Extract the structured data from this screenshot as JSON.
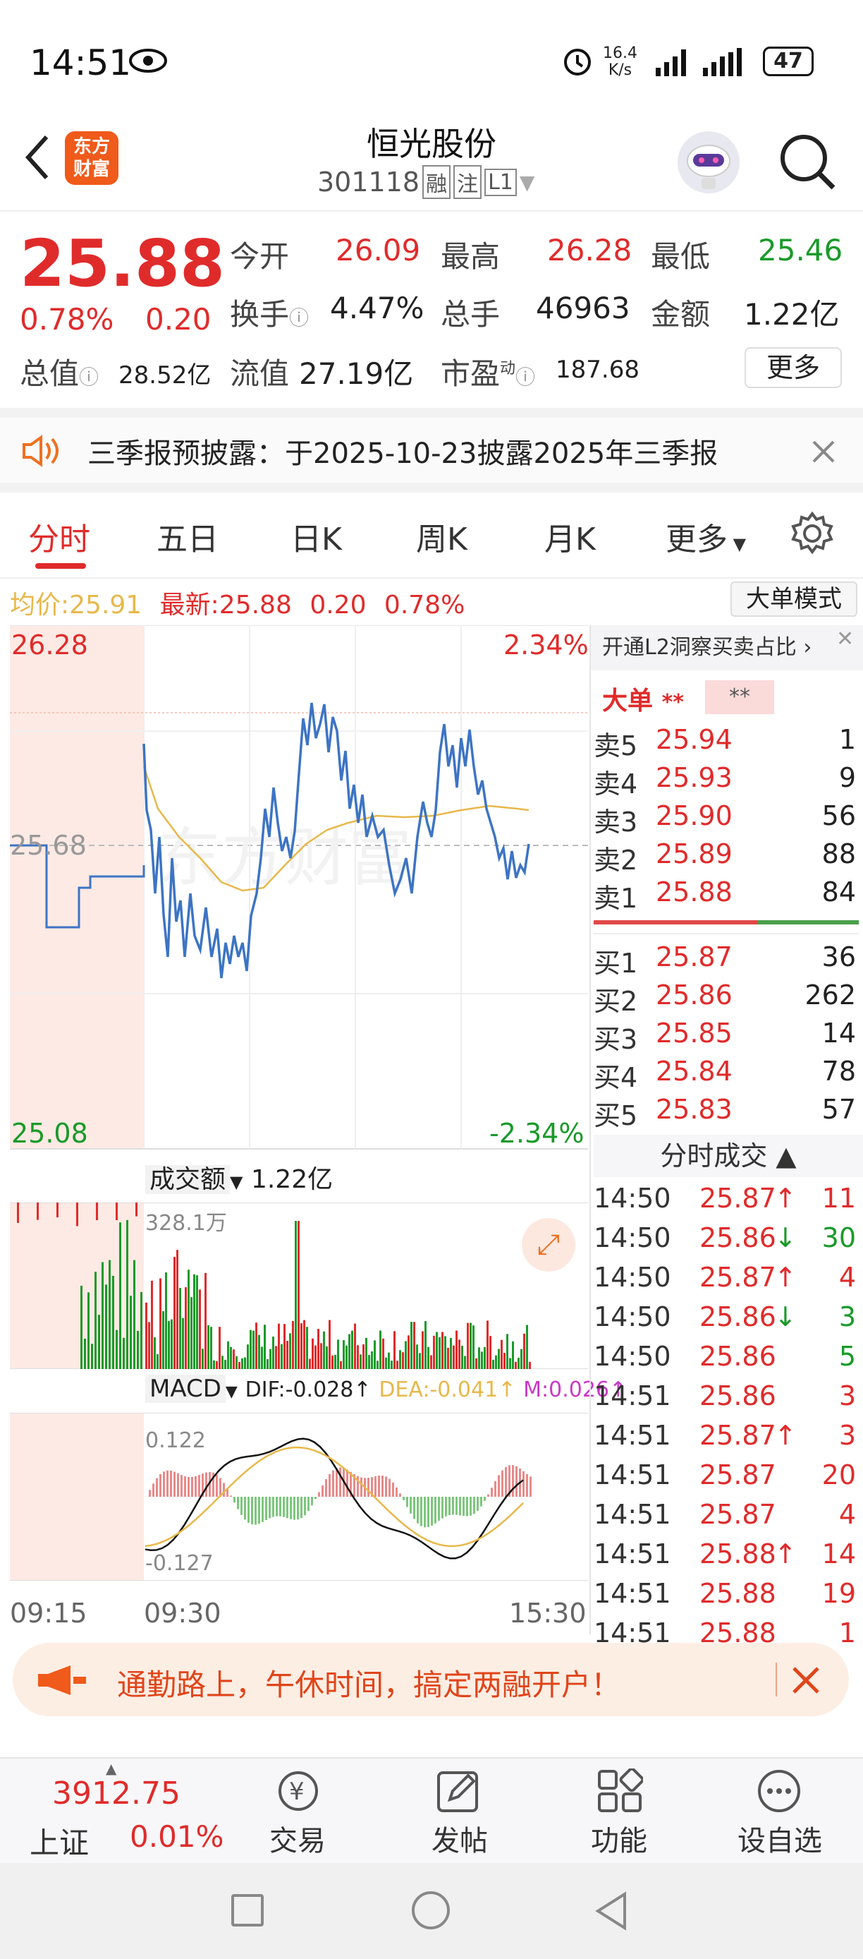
{
  "status": {
    "time": "14:51",
    "speed": "16.4",
    "speed_unit": "K/s",
    "battery": "47"
  },
  "nav": {
    "title": "恒光股份",
    "code": "301118",
    "tags": [
      "融",
      "注",
      "L1"
    ],
    "logo_line1": "东方",
    "logo_line2": "财富"
  },
  "quote": {
    "price": "25.88",
    "pct": "0.78%",
    "change": "0.20",
    "open_label": "今开",
    "open": "26.09",
    "high_label": "最高",
    "high": "26.28",
    "low_label": "最低",
    "low": "25.46",
    "turnover_label": "换手",
    "turnover": "4.47%",
    "volume_label": "总手",
    "volume": "46963",
    "amount_label": "金额",
    "amount": "1.22亿",
    "mktcap_label": "总值",
    "mktcap": "28.52亿",
    "float_label": "流值",
    "float": "27.19亿",
    "pe_label": "市盈",
    "pe_sup": "动",
    "pe": "187.68",
    "more": "更多"
  },
  "notice": {
    "text": "三季报预披露：于2025-10-23披露2025年三季报"
  },
  "tabs": [
    "分时",
    "五日",
    "日K",
    "周K",
    "月K",
    "更多"
  ],
  "chart": {
    "avg_label": "均价:",
    "avg": "25.91",
    "last_label": "最新:",
    "last": "25.88",
    "chg": "0.20",
    "pct": "0.78%",
    "mode": "大单模式",
    "top_price": "26.28",
    "top_pct": "2.34%",
    "mid_price": "25.68",
    "bottom_price": "25.08",
    "bottom_pct": "-2.34%",
    "vol_label": "成交额",
    "vol_total": "1.22亿",
    "vol_max": "328.1万",
    "macd_label": "MACD",
    "dif": "DIF:-0.028",
    "dea": "DEA:-0.041",
    "m": "M:0.026",
    "macd_top": "0.122",
    "macd_bottom": "-0.127",
    "t_start": "09:15",
    "t_open": "09:30",
    "t_end": "15:30"
  },
  "orderbook": {
    "promo": "开通L2洞察买卖占比",
    "big_label": "大单",
    "big_val1": "**",
    "big_val2": "**",
    "asks": [
      {
        "label": "卖5",
        "price": "25.94",
        "qty": "1"
      },
      {
        "label": "卖4",
        "price": "25.93",
        "qty": "9"
      },
      {
        "label": "卖3",
        "price": "25.90",
        "qty": "56"
      },
      {
        "label": "卖2",
        "price": "25.89",
        "qty": "88"
      },
      {
        "label": "卖1",
        "price": "25.88",
        "qty": "84"
      }
    ],
    "bids": [
      {
        "label": "买1",
        "price": "25.87",
        "qty": "36"
      },
      {
        "label": "买2",
        "price": "25.86",
        "qty": "262"
      },
      {
        "label": "买3",
        "price": "25.85",
        "qty": "14"
      },
      {
        "label": "买4",
        "price": "25.84",
        "qty": "78"
      },
      {
        "label": "买5",
        "price": "25.83",
        "qty": "57"
      }
    ]
  },
  "trades": {
    "title": "分时成交",
    "rows": [
      {
        "t": "14:50",
        "p": "25.87",
        "d": "↑",
        "q": "11",
        "c": "red"
      },
      {
        "t": "14:50",
        "p": "25.86",
        "d": "↓",
        "q": "30",
        "c": "green"
      },
      {
        "t": "14:50",
        "p": "25.87",
        "d": "↑",
        "q": "4",
        "c": "red"
      },
      {
        "t": "14:50",
        "p": "25.86",
        "d": "↓",
        "q": "3",
        "c": "green"
      },
      {
        "t": "14:50",
        "p": "25.86",
        "d": "",
        "q": "5",
        "c": "green"
      },
      {
        "t": "14:51",
        "p": "25.86",
        "d": "",
        "q": "3",
        "c": "red"
      },
      {
        "t": "14:51",
        "p": "25.87",
        "d": "↑",
        "q": "3",
        "c": "red"
      },
      {
        "t": "14:51",
        "p": "25.87",
        "d": "",
        "q": "20",
        "c": "red"
      },
      {
        "t": "14:51",
        "p": "25.87",
        "d": "",
        "q": "4",
        "c": "red"
      },
      {
        "t": "14:51",
        "p": "25.88",
        "d": "↑",
        "q": "14",
        "c": "red"
      },
      {
        "t": "14:51",
        "p": "25.88",
        "d": "",
        "q": "19",
        "c": "red"
      },
      {
        "t": "14:51",
        "p": "25.88",
        "d": "",
        "q": "1",
        "c": "red"
      }
    ]
  },
  "banner": {
    "text": "通勤路上，午休时间，搞定两融开户！"
  },
  "bottom": {
    "index_value": "3912.75",
    "index_name": "上证",
    "index_pct": "0.01%",
    "items": [
      "交易",
      "发帖",
      "功能",
      "设自选"
    ]
  },
  "colors": {
    "up": "#e02b2b",
    "down": "#1a9a2a",
    "price_line": "#3d74c4",
    "avg_line": "#e8b84a",
    "accent": "#f07020"
  }
}
